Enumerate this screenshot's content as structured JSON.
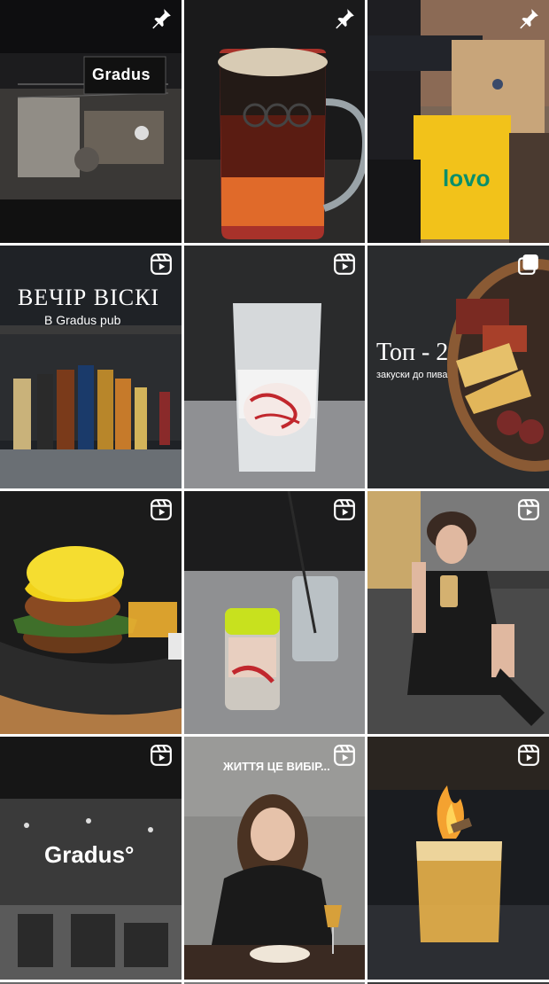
{
  "icons": [
    "pin-icon",
    "reels-icon",
    "carousel-icon"
  ],
  "colors": {
    "separator": "#ffffff",
    "badge": "#ffffff",
    "glovo_yellow": "#f2c21a",
    "mustard": "#f1d21a"
  },
  "grid": {
    "posts": [
      {
        "badge": "pin-icon",
        "overlay": {
          "brand": "Gradus"
        }
      },
      {
        "badge": "pin-icon",
        "overlay": {}
      },
      {
        "badge": "pin-icon",
        "overlay": {
          "brand": "lovo"
        }
      },
      {
        "badge": "reels-icon",
        "overlay": {
          "title": "ВЕЧІР ВІСКІ",
          "subtitle": "В Gradus pub"
        }
      },
      {
        "badge": "reels-icon",
        "overlay": {}
      },
      {
        "badge": "carousel-icon",
        "overlay": {
          "title": "Топ - 2",
          "subtitle": "закуски до пива"
        }
      },
      {
        "badge": "reels-icon",
        "overlay": {}
      },
      {
        "badge": "reels-icon",
        "overlay": {}
      },
      {
        "badge": "reels-icon",
        "overlay": {}
      },
      {
        "badge": "reels-icon",
        "overlay": {
          "brand": "Gradus°"
        }
      },
      {
        "badge": "reels-icon",
        "overlay": {
          "caption": "ЖИТТЯ ЦЕ ВИБІР..."
        }
      },
      {
        "badge": "reels-icon",
        "overlay": {}
      }
    ]
  }
}
